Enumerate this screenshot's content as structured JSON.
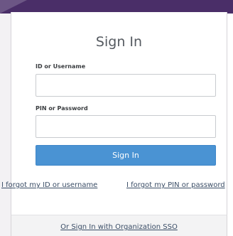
{
  "colors": {
    "header_bar": "#4a2e68",
    "primary_button": "#4a93d3",
    "link": "#3a4d66",
    "title_text": "#555a60"
  },
  "form": {
    "title": "Sign In",
    "username": {
      "label": "ID or Username",
      "value": "",
      "placeholder": ""
    },
    "password": {
      "label": "PIN or Password",
      "value": "",
      "placeholder": ""
    },
    "submit_label": "Sign In"
  },
  "links": {
    "forgot_id": "I forgot my ID or username",
    "forgot_pin": "I forgot my PIN or password"
  },
  "footer": {
    "sso_label": "Or Sign In with Organization SSO"
  }
}
